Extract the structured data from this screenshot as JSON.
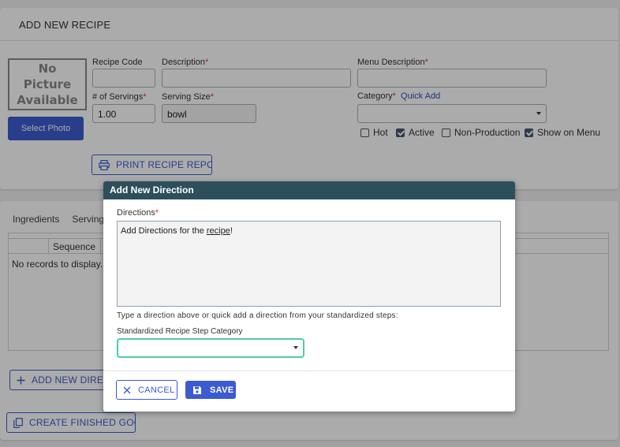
{
  "page": {
    "title": "ADD NEW RECIPE"
  },
  "photo": {
    "placeholder_text": "No Picture Available",
    "select_label": "Select Photo"
  },
  "form": {
    "recipe_code": {
      "label": "Recipe Code",
      "value": ""
    },
    "description": {
      "label": "Description",
      "required_mark": "*",
      "value": ""
    },
    "menu_description": {
      "label": "Menu Description",
      "required_mark": "*",
      "value": ""
    },
    "servings": {
      "label": "# of Servings",
      "required_mark": "*",
      "value": "1.00"
    },
    "serving_size": {
      "label": "Serving Size",
      "required_mark": "*",
      "value": "bowl"
    },
    "category": {
      "label": "Category",
      "required_mark": "*",
      "quick_add": "Quick Add",
      "value": ""
    },
    "checkboxes": [
      {
        "label": "Hot",
        "checked": false
      },
      {
        "label": "Active",
        "checked": true
      },
      {
        "label": "Non-Production",
        "checked": false
      },
      {
        "label": "Show on Menu",
        "checked": true
      }
    ],
    "print_report_label": "PRINT RECIPE REPORT"
  },
  "tabs": [
    "Ingredients",
    "Servings"
  ],
  "grid": {
    "columns": [
      "Sequence"
    ],
    "empty_text": "No records to display."
  },
  "add_direction_label": "ADD NEW DIRECTION",
  "create_finished_good_label": "CREATE FINISHED GOOD",
  "modal": {
    "title": "Add New Direction",
    "directions_label": "Directions",
    "required_mark": "*",
    "directions_text_pre": "Add Directions for the ",
    "directions_text_link": "recipe",
    "directions_text_post": "!",
    "help_text": "Type a direction above or quick add a direction from your standardized steps:",
    "std_step_label": "Standardized Recipe Step Category",
    "std_step_value": "",
    "cancel_label": "CANCEL",
    "save_label": "SAVE"
  },
  "colors": {
    "accent": "#3c5bd0",
    "modal_header": "#2d4f5c",
    "required": "#d23b3b",
    "focus": "#4fcfa0"
  }
}
